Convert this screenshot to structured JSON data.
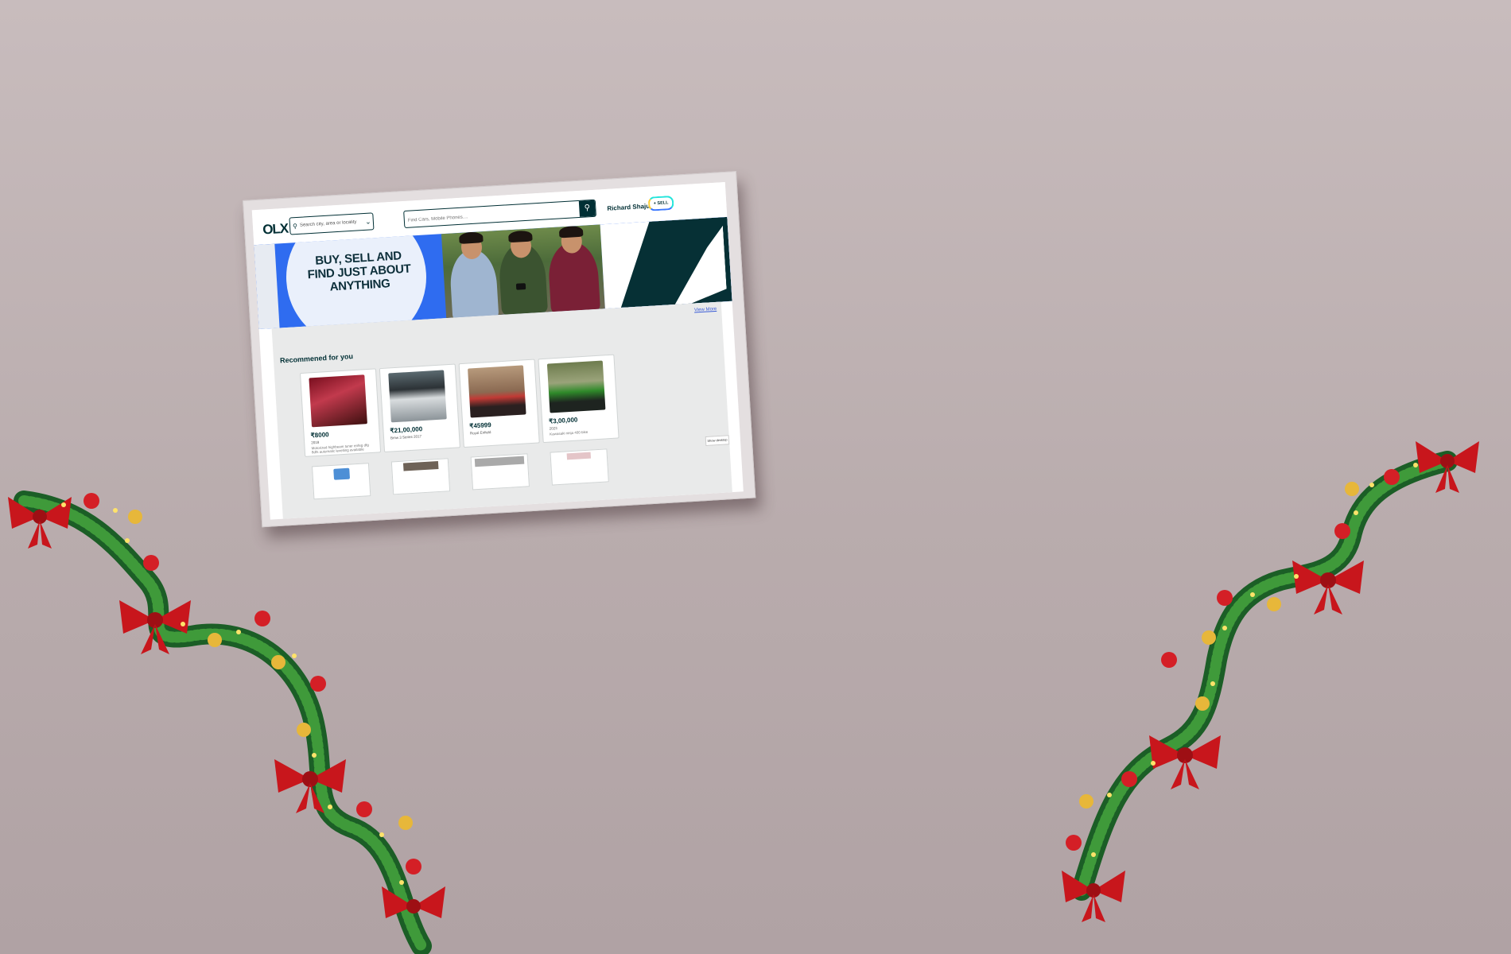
{
  "header": {
    "logo": "OLX",
    "location_placeholder": "Search city, area or locality",
    "search_placeholder": "Find Cars, Mobile Phones....",
    "user_name": "Richard Shaju",
    "sell_label": "+ SELL"
  },
  "banner": {
    "headline": "BUY, SELL AND FIND JUST ABOUT ANYTHING"
  },
  "recommended": {
    "title": "Recommened for you",
    "view_more": "View More",
    "show_desktop": "Show desktop",
    "cards": [
      {
        "price": "₹8000",
        "sub": "2018",
        "sub2": "Motorized highbeam tuner enfeg dfg 8dfs automatic levelling available"
      },
      {
        "price": "₹21,00,000",
        "sub": "Bmw 3 Series 2017",
        "sub2": ""
      },
      {
        "price": "₹45999",
        "sub": "Royal Enfield",
        "sub2": ""
      },
      {
        "price": "₹3,00,000",
        "sub": "2023",
        "sub2": "Kawasaki ninja 400 bike"
      }
    ]
  },
  "colors": {
    "brand_dark": "#002f34",
    "banner_blue": "#2f6cf0",
    "garland_green": "#1f6b2a",
    "ribbon_red": "#c8161c"
  },
  "icons": [
    "search-icon",
    "chevron-down-icon",
    "plus-icon",
    "olx-logo",
    "garland-decoration"
  ]
}
